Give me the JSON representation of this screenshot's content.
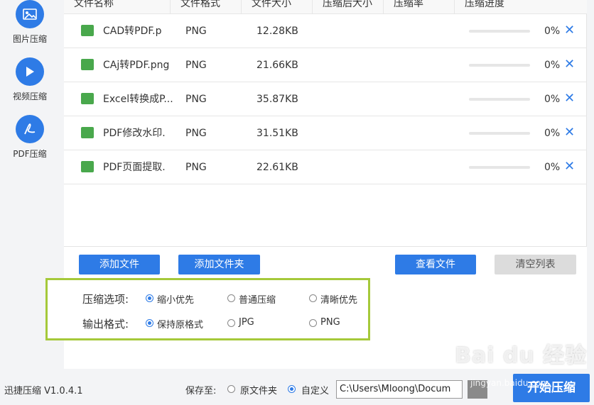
{
  "sidebar": {
    "items": [
      {
        "label": "图片压缩",
        "icon": "image-icon"
      },
      {
        "label": "视频压缩",
        "icon": "play-icon"
      },
      {
        "label": "PDF压缩",
        "icon": "pdf-icon"
      }
    ]
  },
  "table": {
    "headers": [
      "文件名称",
      "文件格式",
      "文件大小",
      "压缩后大小",
      "压缩率",
      "压缩进度"
    ],
    "rows": [
      {
        "name": "CAD转PDF.p",
        "format": "PNG",
        "size": "12.28KB",
        "compressed": "",
        "ratio": "",
        "progress": "0%"
      },
      {
        "name": "CAj转PDF.png",
        "format": "PNG",
        "size": "21.66KB",
        "compressed": "",
        "ratio": "",
        "progress": "0%"
      },
      {
        "name": "Excel转换成P...",
        "format": "PNG",
        "size": "35.87KB",
        "compressed": "",
        "ratio": "",
        "progress": "0%"
      },
      {
        "name": "PDF修改水印.",
        "format": "PNG",
        "size": "31.51KB",
        "compressed": "",
        "ratio": "",
        "progress": "0%"
      },
      {
        "name": "PDF页面提取.",
        "format": "PNG",
        "size": "22.61KB",
        "compressed": "",
        "ratio": "",
        "progress": "0%"
      }
    ],
    "delete_glyph": "✕"
  },
  "actions": {
    "add_file": "添加文件",
    "add_folder": "添加文件夹",
    "view_files": "查看文件",
    "clear_list": "清空列表"
  },
  "options": {
    "compress_label": "压缩选项:",
    "compress_choices": [
      "缩小优先",
      "普通压缩",
      "清晰优先"
    ],
    "compress_selected": "缩小优先",
    "format_label": "输出格式:",
    "format_choices": [
      "保持原格式",
      "JPG",
      "PNG"
    ],
    "format_selected": "保持原格式"
  },
  "footer": {
    "version": "迅捷压缩 V1.0.4.1",
    "save_to": "保存至:",
    "save_choices": [
      "原文件夹",
      "自定义"
    ],
    "save_selected": "自定义",
    "path": "C:\\Users\\Mloong\\Docum",
    "start_button": "开始压缩"
  },
  "watermark": {
    "text": "Bai du 经验",
    "url": "jingyan.baidu.com"
  },
  "colors": {
    "accent": "#2e7be6",
    "highlight_border": "#a5c93a",
    "file_icon": "#49a84c"
  }
}
